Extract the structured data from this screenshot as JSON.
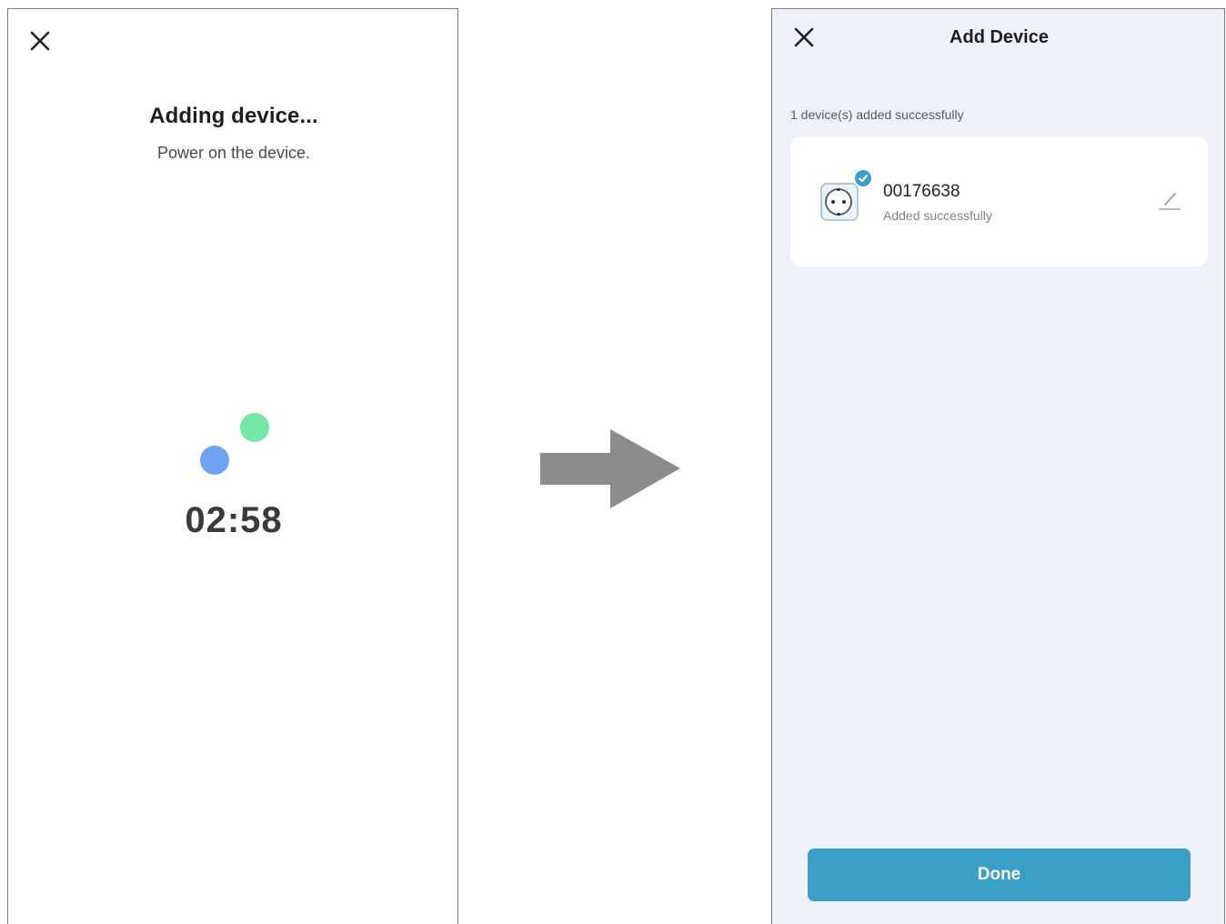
{
  "left_screen": {
    "close_icon": "close-icon",
    "title": "Adding device...",
    "subtitle": "Power on the device.",
    "timer": "02:58",
    "spinner_colors": {
      "green": "#74e8a6",
      "blue": "#6ea3f2"
    }
  },
  "transition": {
    "icon": "right-arrow-icon",
    "color": "#8c8c8c"
  },
  "right_screen": {
    "close_icon": "close-icon",
    "title": "Add Device",
    "success_count_text": "1 device(s) added successfully",
    "devices": [
      {
        "icon": "smart-plug-icon",
        "badge_icon": "check-icon",
        "name": "00176638",
        "status": "Added successfully",
        "edit_icon": "pencil-icon"
      }
    ],
    "done_label": "Done",
    "colors": {
      "background": "#eef1fa",
      "accent": "#3a9fc6",
      "card": "#ffffff"
    }
  }
}
